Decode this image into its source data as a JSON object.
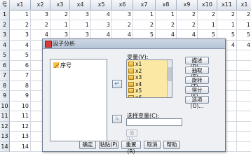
{
  "sheet": {
    "headers": [
      "号",
      "x1",
      "x2",
      "x3",
      "x4",
      "x5",
      "x6",
      "x7",
      "x8",
      "x9",
      "x10",
      "x11",
      "x1"
    ],
    "row_numbers": [
      "1",
      "2",
      "3",
      "4",
      "5",
      "6",
      "7",
      "8",
      "9",
      "10",
      "11",
      "12",
      "13",
      "14"
    ],
    "rows": [
      [
        "1",
        "3",
        "2",
        "3",
        "4",
        "3",
        "1",
        "1",
        "2",
        "2",
        "2",
        "2"
      ],
      [
        "2",
        "2",
        "1",
        "1",
        "3",
        "2",
        "2",
        "2",
        "2",
        "1",
        "1",
        "1"
      ],
      [
        "3",
        "4",
        "3",
        "3",
        "4",
        "4",
        "5",
        "4",
        "4",
        "5",
        "5",
        "5"
      ],
      [
        "4",
        "3",
        "3",
        "4",
        "4",
        "3",
        "3",
        "3",
        "5",
        "3",
        "4",
        "4"
      ],
      [
        "5",
        "",
        "",
        "",
        "",
        "",
        "",
        "",
        "",
        "",
        "",
        ""
      ],
      [
        "6",
        "",
        "",
        "",
        "",
        "",
        "",
        "",
        "",
        "",
        "",
        ""
      ],
      [
        "7",
        "",
        "",
        "",
        "",
        "",
        "",
        "",
        "",
        "",
        "",
        ""
      ],
      [
        "8",
        "",
        "",
        "",
        "",
        "",
        "",
        "",
        "",
        "",
        "",
        ""
      ],
      [
        "9",
        "",
        "",
        "",
        "",
        "",
        "",
        "",
        "",
        "",
        "",
        ""
      ],
      [
        "10",
        "",
        "",
        "",
        "",
        "",
        "",
        "",
        "",
        "",
        "",
        ""
      ],
      [
        "11",
        "",
        "",
        "",
        "",
        "",
        "",
        "",
        "",
        "",
        "",
        ""
      ],
      [
        "12",
        "",
        "",
        "",
        "",
        "",
        "",
        "",
        "",
        "",
        "",
        ""
      ],
      [
        "13",
        "",
        "",
        "",
        "",
        "",
        "",
        "",
        "",
        "",
        "",
        ""
      ],
      [
        "14",
        "",
        "",
        "",
        "",
        "",
        "",
        "",
        "",
        "",
        "",
        ""
      ]
    ]
  },
  "dialog": {
    "title": "因子分析",
    "source_items": [
      "序号"
    ],
    "variables_label": "变量(V):",
    "variables": [
      "x1",
      "x2",
      "x3",
      "x4",
      "x5",
      "x6",
      "x7"
    ],
    "selection_label": "选择变量(C):",
    "value_button": "值(L)...",
    "side_buttons": [
      "描述(D)...",
      "抽取(E)...",
      "旋转(T)...",
      "得分(S)...",
      "选项(O)..."
    ],
    "bottom_buttons": [
      "确定",
      "粘贴(P)",
      "重置(R)",
      "取消",
      "帮助"
    ]
  }
}
